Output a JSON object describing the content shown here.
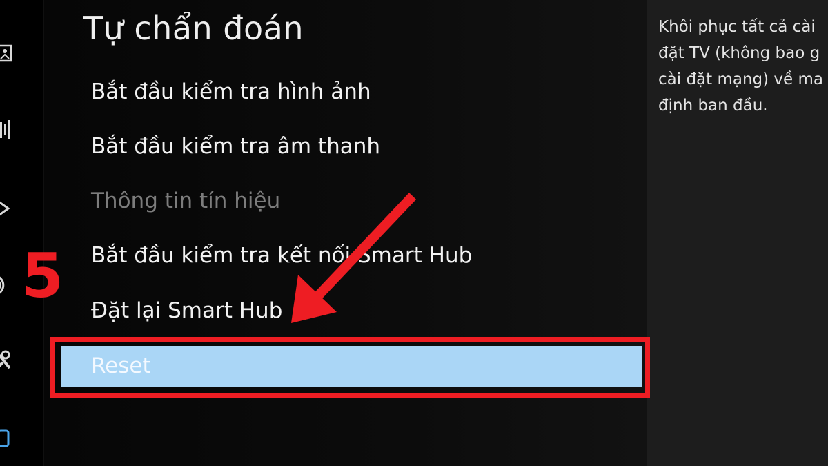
{
  "menu": {
    "title": "Tự chẩn đoán",
    "items": [
      {
        "label": "Bắt đầu kiểm tra hình ảnh",
        "enabled": true
      },
      {
        "label": "Bắt đầu kiểm tra âm thanh",
        "enabled": true
      },
      {
        "label": "Thông tin tín hiệu",
        "enabled": false
      },
      {
        "label": "Bắt đầu kiểm tra kết nối Smart Hub",
        "enabled": true
      },
      {
        "label": "Đặt lại Smart Hub",
        "enabled": true
      }
    ],
    "selected": {
      "label": "Reset"
    }
  },
  "description": {
    "text": "Khôi phục tất cả cài\nđặt TV (không bao g\ncài đặt mạng) về ma\nđịnh ban đầu."
  },
  "annotation": {
    "step_number": "5",
    "color": "#ee1d23"
  },
  "sidebar": {
    "icons": [
      "picture-icon",
      "sound-icon",
      "broadcast-icon",
      "network-icon",
      "support-icon",
      "general-icon"
    ]
  },
  "colors": {
    "selected_row": "#aad6f6",
    "disabled_text": "#7c7c7c",
    "description_panel": "#1d1d1d"
  }
}
